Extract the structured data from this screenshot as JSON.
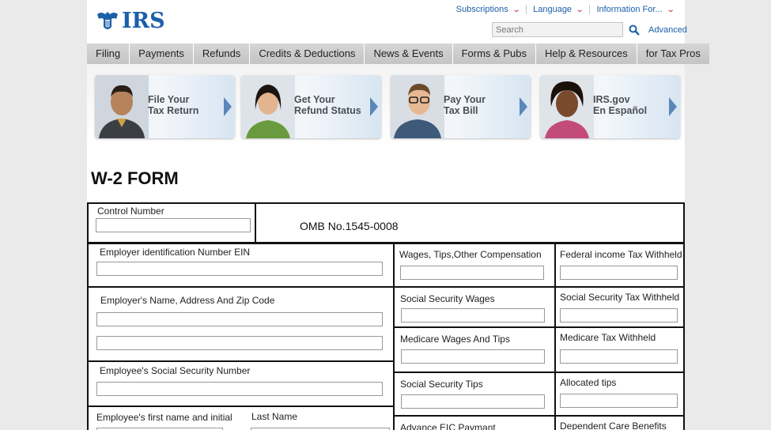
{
  "header": {
    "logo_text": "IRS",
    "top_links": [
      {
        "label": "Subscriptions"
      },
      {
        "label": "Language"
      },
      {
        "label": "Information For..."
      }
    ],
    "search": {
      "placeholder": "Search"
    },
    "advanced_label": "Advanced"
  },
  "nav": {
    "items": [
      "Filing",
      "Payments",
      "Refunds",
      "Credits & Deductions",
      "News & Events",
      "Forms & Pubs",
      "Help & Resources",
      "for Tax Pros"
    ]
  },
  "promos": [
    {
      "line1": "File Your",
      "line2": "Tax Return"
    },
    {
      "line1": "Get Your",
      "line2": "Refund Status"
    },
    {
      "line1": "Pay Your",
      "line2": "Tax Bill"
    },
    {
      "line1": "IRS.gov",
      "line2": "En Español"
    }
  ],
  "form": {
    "title": "W-2 FORM",
    "omb": "OMB No.1545-0008",
    "labels": {
      "control_number": "Control Number",
      "ein": "Employer identification Number EIN",
      "employer_name": "Employer's Name, Address And Zip Code",
      "employee_ssn": "Employee's Social Security Number",
      "first_name": "Employee's first name and initial",
      "last_name": "Last Name",
      "wages": "Wages, Tips,Other Compensation",
      "federal_tax": "Federal income Tax Withheld",
      "ss_wages": "Social Security Wages",
      "ss_tax": "Social Security Tax Withheld",
      "medicare_wages": "Medicare Wages And Tips",
      "medicare_tax": "Medicare Tax Withheld",
      "ss_tips": "Social Security Tips",
      "allocated_tips": "Allocated tips",
      "advance_eic": "Advance EIC Paymant",
      "dependent_care": "Dependent Care Benefits"
    }
  },
  "colors": {
    "link": "#1b5fa8",
    "chevron": "#c0272d",
    "nav_bg": "#c9c9c9"
  }
}
